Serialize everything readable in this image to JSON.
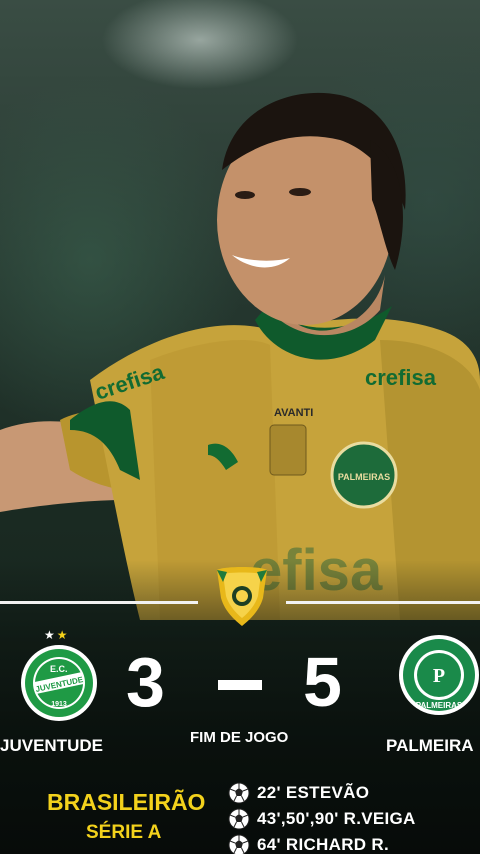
{
  "match": {
    "league": {
      "name": "BRASILEIRÃO",
      "series": "SÉRIE A",
      "badge_icon": "brasileirao-trophy-icon"
    },
    "status": "FIM DE JOGO",
    "home": {
      "name": "JUVENTUDE",
      "score": "3",
      "crest_icon": "juventude-crest-icon",
      "stars_icon": "two-stars-icon",
      "colors": {
        "primary": "#1f9a45",
        "secondary": "#ffffff"
      }
    },
    "away": {
      "name": "PALMEIRA",
      "score": "5",
      "crest_icon": "palmeiras-crest-icon",
      "colors": {
        "primary": "#1a8a4a",
        "secondary": "#ffffff"
      }
    },
    "score_separator": "–",
    "scorers": [
      {
        "text": "22' ESTEVÃO",
        "icon": "soccer-ball-icon"
      },
      {
        "text": "43',50',90' R.VEIGA",
        "icon": "soccer-ball-icon"
      },
      {
        "text": "64' RICHARD R.",
        "icon": "soccer-ball-icon"
      }
    ]
  },
  "photo": {
    "description_icon": "player-celebration-photo",
    "jersey_texts": [
      "crefisa",
      "AVANTI",
      "PALMEIRAS"
    ]
  },
  "colors": {
    "accent_yellow": "#f3d21c",
    "jersey_gold": "#c9a63a",
    "jersey_green": "#0f5a2c",
    "background": "#0f1a14"
  }
}
